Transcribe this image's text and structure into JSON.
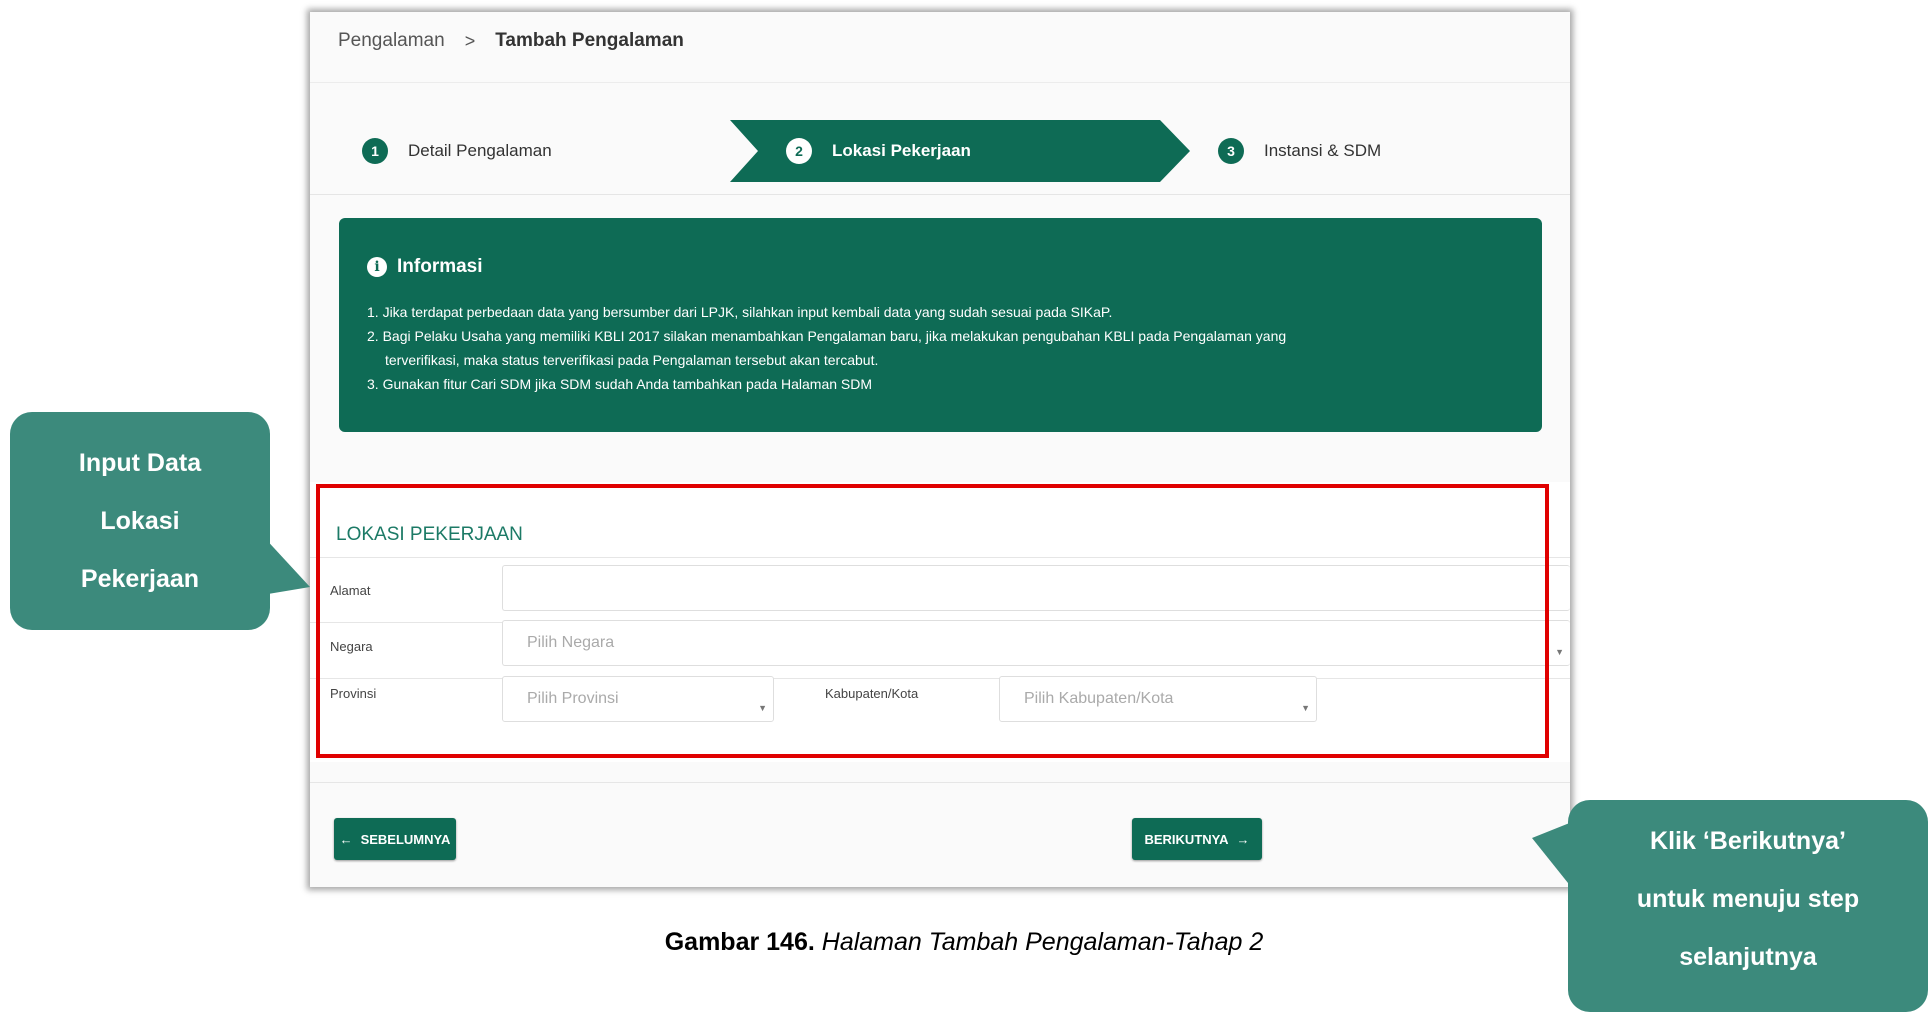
{
  "breadcrumb": {
    "parent": "Pengalaman",
    "separator": ">",
    "current": "Tambah Pengalaman"
  },
  "steps": [
    {
      "number": "1",
      "label": "Detail Pengalaman"
    },
    {
      "number": "2",
      "label": "Lokasi Pekerjaan"
    },
    {
      "number": "3",
      "label": "Instansi & SDM"
    }
  ],
  "info": {
    "title": "Informasi",
    "line1": "1. Jika terdapat perbedaan data yang bersumber dari LPJK, silahkan input kembali data yang sudah sesuai pada SIKaP.",
    "line2a": "2. Bagi Pelaku Usaha yang memiliki KBLI 2017 silakan menambahkan Pengalaman baru, jika melakukan pengubahan KBLI pada Pengalaman yang",
    "line2b": "terverifikasi, maka status terverifikasi pada Pengalaman tersebut akan tercabut.",
    "line3": "3. Gunakan fitur Cari SDM jika SDM sudah Anda tambahkan pada Halaman SDM"
  },
  "form": {
    "section_title": "LOKASI PEKERJAAN",
    "alamat_label": "Alamat",
    "alamat_value": "",
    "negara_label": "Negara",
    "negara_placeholder": "Pilih Negara",
    "provinsi_label": "Provinsi",
    "provinsi_placeholder": "Pilih Provinsi",
    "kabupaten_label": "Kabupaten/Kota",
    "kabupaten_placeholder": "Pilih Kabupaten/Kota"
  },
  "buttons": {
    "prev": "SEBELUMNYA",
    "next": "BERIKUTNYA"
  },
  "callouts": {
    "left": [
      "Input Data",
      "Lokasi",
      "Pekerjaan"
    ],
    "right": [
      "Klik ‘Berikutnya’",
      "untuk menuju step",
      "selanjutnya"
    ]
  },
  "caption": {
    "number": "Gambar 146.",
    "text": "Halaman Tambah Pengalaman-Tahap 2"
  },
  "colors": {
    "primary": "#0e6b55",
    "callout": "#3c8a7c",
    "highlight": "#e00000"
  }
}
